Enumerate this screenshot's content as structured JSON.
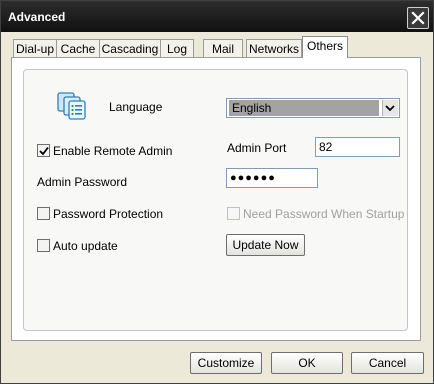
{
  "window": {
    "title": "Advanced"
  },
  "tabs": [
    "Dial-up",
    "Cache",
    "Cascading",
    "Log",
    "Mail",
    "Networks",
    "Others"
  ],
  "active_tab": "Others",
  "others": {
    "language_label": "Language",
    "language_value": "English",
    "enable_remote_admin_label": "Enable Remote Admin",
    "enable_remote_admin_checked": true,
    "admin_port_label": "Admin Port",
    "admin_port_value": "82",
    "admin_password_label": "Admin Password",
    "admin_password_value": "●●●●●●",
    "password_protection_label": "Password Protection",
    "password_protection_checked": false,
    "need_password_label": "Need Password When Startup",
    "need_password_enabled": false,
    "auto_update_label": "Auto update",
    "auto_update_checked": false,
    "update_now_label": "Update Now"
  },
  "buttons": {
    "customize": "Customize",
    "ok": "OK",
    "cancel": "Cancel"
  },
  "icons": {
    "close": "close-icon",
    "language": "language-icon",
    "check": "check-icon",
    "dropdown": "chevron-down-icon"
  },
  "colors": {
    "titlebar": "#1a1a1a",
    "panel": "#ffffff",
    "select_highlight": "#a3a3a3"
  }
}
